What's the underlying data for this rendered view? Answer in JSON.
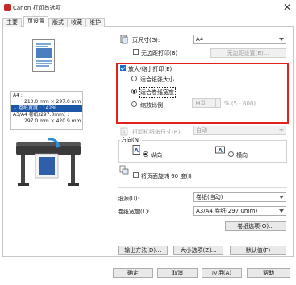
{
  "window": {
    "title": "打印首选项",
    "brand": "Canon"
  },
  "tabs": [
    {
      "label": "主要",
      "active": false
    },
    {
      "label": "页设置",
      "active": true
    },
    {
      "label": "版式",
      "active": false
    },
    {
      "label": "收藏",
      "active": false
    },
    {
      "label": "维护",
      "active": false
    }
  ],
  "info": {
    "line1": "A4 :",
    "line2": "210.0 mm × 297.0 mm",
    "line3": "卷纸宽度 : 142%",
    "line4": "A3/A4 卷纸(297.0mm) :",
    "line5": "297.0 mm × 420.9 mm"
  },
  "page_size": {
    "label": "页尺寸(G):",
    "value": "A4"
  },
  "borderless": {
    "label": "无边距打印(B)",
    "checked": false,
    "settings_button": "无边距设置(B)..."
  },
  "scaling": {
    "checkbox_label": "放大/缩小打印(E)",
    "checked": true,
    "options": [
      {
        "label": "适合纸张大小",
        "checked": false
      },
      {
        "label": "适合卷纸宽度",
        "checked": true
      },
      {
        "label": "缩放比例",
        "checked": false
      }
    ],
    "ratio_value": "自动",
    "ratio_hint": "% (5 - 600)"
  },
  "output_paper": {
    "label": "打印机纸张尺寸(R):",
    "value": "自动"
  },
  "orientation": {
    "title": "方向(N)",
    "portrait": "纵向",
    "landscape": "横向",
    "selected": "portrait"
  },
  "rotate": {
    "label": "将页面旋转 90 度(I)",
    "checked": false
  },
  "paper_source": {
    "label": "纸源(U):",
    "value": "卷纸(自动)"
  },
  "roll_width": {
    "label": "卷纸宽度(L):",
    "value": "A3/A4 卷纸(297.0mm)"
  },
  "roll_options_button": "卷纸选项(O)...",
  "lower_buttons": {
    "output": "输出方法(D)...",
    "size_options": "大小选项(Z)...",
    "defaults": "默认值(F)"
  },
  "footer": {
    "ok": "确定",
    "cancel": "取消",
    "apply": "应用(A)",
    "help": "帮助"
  }
}
